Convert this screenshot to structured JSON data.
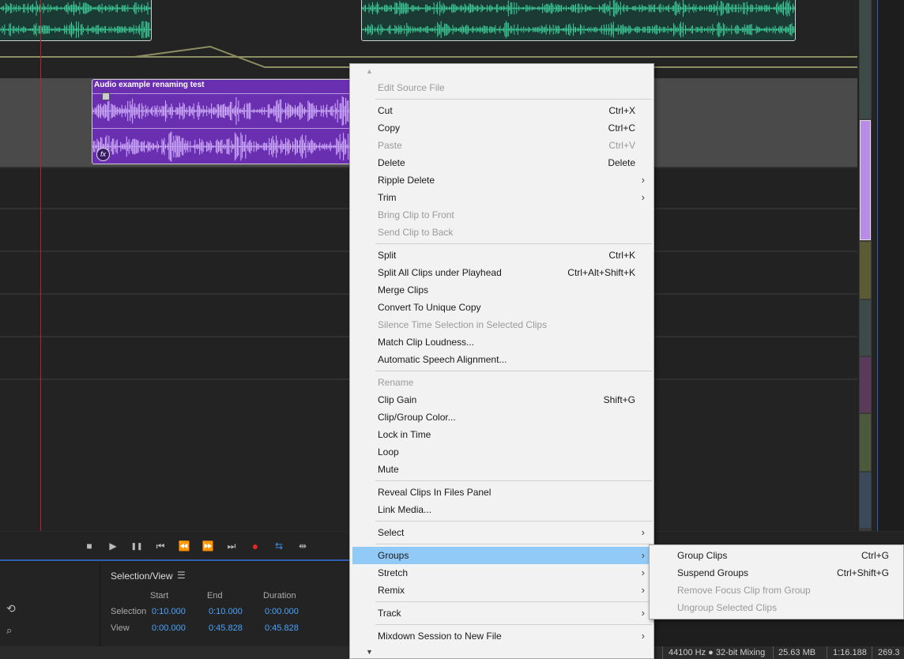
{
  "timeline": {
    "selected_clip_title": "Audio example renaming test",
    "fx_badge": "fx"
  },
  "transport": {
    "stop_icon": "■",
    "play_icon": "▶",
    "pause_icon": "❚❚",
    "to_start_icon": "⏮",
    "rewind_icon": "⏪",
    "ffwd_icon": "⏩",
    "to_end_icon": "⏭",
    "record_icon": "●",
    "loop_icon": "⇆",
    "skip_icon": "⇹"
  },
  "selection_view": {
    "title": "Selection/View",
    "menu_icon": "☰",
    "columns": [
      "Start",
      "End",
      "Duration"
    ],
    "rows": [
      {
        "label": "Selection",
        "start": "0:10.000",
        "end": "0:10.000",
        "duration": "0:00.000"
      },
      {
        "label": "View",
        "start": "0:00.000",
        "end": "0:45.828",
        "duration": "0:45.828"
      }
    ]
  },
  "status_bar": {
    "sample_rate": "44100 Hz ● 32-bit Mixing",
    "file_size": "25.63 MB",
    "duration": "1:16.188",
    "free_space": "269.3"
  },
  "context_menu": {
    "items": [
      {
        "label": "Edit Source File",
        "shortcut": "",
        "disabled": true,
        "submenu": false
      },
      {
        "label": "Cut",
        "shortcut": "Ctrl+X",
        "disabled": false,
        "submenu": false
      },
      {
        "label": "Copy",
        "shortcut": "Ctrl+C",
        "disabled": false,
        "submenu": false
      },
      {
        "label": "Paste",
        "shortcut": "Ctrl+V",
        "disabled": true,
        "submenu": false
      },
      {
        "label": "Delete",
        "shortcut": "Delete",
        "disabled": false,
        "submenu": false
      },
      {
        "label": "Ripple Delete",
        "shortcut": "",
        "disabled": false,
        "submenu": true
      },
      {
        "label": "Trim",
        "shortcut": "",
        "disabled": false,
        "submenu": true
      },
      {
        "label": "Bring Clip to Front",
        "shortcut": "",
        "disabled": true,
        "submenu": false
      },
      {
        "label": "Send Clip to Back",
        "shortcut": "",
        "disabled": true,
        "submenu": false
      },
      {
        "label": "Split",
        "shortcut": "Ctrl+K",
        "disabled": false,
        "submenu": false
      },
      {
        "label": "Split All Clips under Playhead",
        "shortcut": "Ctrl+Alt+Shift+K",
        "disabled": false,
        "submenu": false
      },
      {
        "label": "Merge Clips",
        "shortcut": "",
        "disabled": false,
        "submenu": false
      },
      {
        "label": "Convert To Unique Copy",
        "shortcut": "",
        "disabled": false,
        "submenu": false
      },
      {
        "label": "Silence Time Selection in Selected Clips",
        "shortcut": "",
        "disabled": true,
        "submenu": false
      },
      {
        "label": "Match Clip Loudness...",
        "shortcut": "",
        "disabled": false,
        "submenu": false
      },
      {
        "label": "Automatic Speech Alignment...",
        "shortcut": "",
        "disabled": false,
        "submenu": false
      },
      {
        "label": "Rename",
        "shortcut": "",
        "disabled": true,
        "submenu": false
      },
      {
        "label": "Clip Gain",
        "shortcut": "Shift+G",
        "disabled": false,
        "submenu": false
      },
      {
        "label": "Clip/Group Color...",
        "shortcut": "",
        "disabled": false,
        "submenu": false
      },
      {
        "label": "Lock in Time",
        "shortcut": "",
        "disabled": false,
        "submenu": false
      },
      {
        "label": "Loop",
        "shortcut": "",
        "disabled": false,
        "submenu": false
      },
      {
        "label": "Mute",
        "shortcut": "",
        "disabled": false,
        "submenu": false
      },
      {
        "label": "Reveal Clips In Files Panel",
        "shortcut": "",
        "disabled": false,
        "submenu": false
      },
      {
        "label": "Link Media...",
        "shortcut": "",
        "disabled": false,
        "submenu": false
      },
      {
        "label": "Select",
        "shortcut": "",
        "disabled": false,
        "submenu": true
      },
      {
        "label": "Groups",
        "shortcut": "",
        "disabled": false,
        "submenu": true,
        "highlighted": true
      },
      {
        "label": "Stretch",
        "shortcut": "",
        "disabled": false,
        "submenu": true
      },
      {
        "label": "Remix",
        "shortcut": "",
        "disabled": false,
        "submenu": true
      },
      {
        "label": "Track",
        "shortcut": "",
        "disabled": false,
        "submenu": true
      },
      {
        "label": "Mixdown Session to New File",
        "shortcut": "",
        "disabled": false,
        "submenu": true
      }
    ],
    "submenu_arrow": "›",
    "scroll_up": "▲",
    "scroll_down": "▼"
  },
  "groups_submenu": {
    "items": [
      {
        "label": "Group Clips",
        "shortcut": "Ctrl+G",
        "disabled": false
      },
      {
        "label": "Suspend Groups",
        "shortcut": "Ctrl+Shift+G",
        "disabled": false
      },
      {
        "label": "Remove Focus Clip from Group",
        "shortcut": "",
        "disabled": true
      },
      {
        "label": "Ungroup Selected Clips",
        "shortcut": "",
        "disabled": true
      }
    ]
  },
  "colors": {
    "green_wave": "#3ecf9a",
    "purple_clip": "#6a2fb0",
    "purple_wave": "#d4b4ff",
    "menu_highlight": "#91c9f7",
    "value_blue": "#4aa3ff",
    "playhead": "#c02020"
  }
}
